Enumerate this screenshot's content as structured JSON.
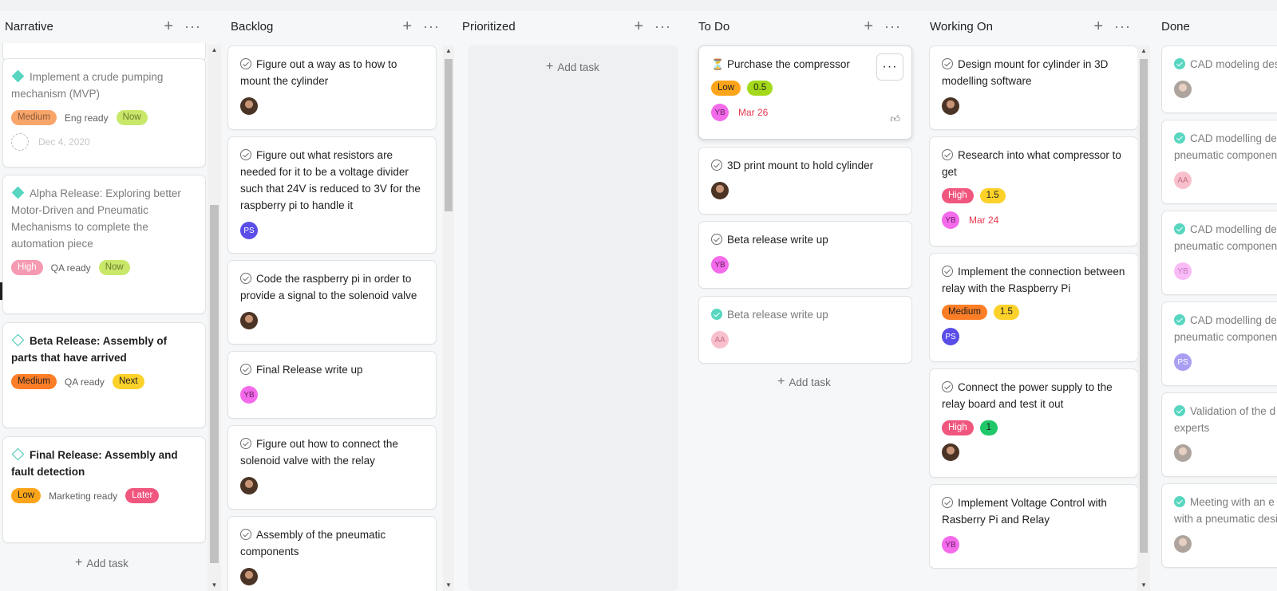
{
  "columns": [
    {
      "title": "Narrative",
      "add_task": "Add task",
      "cards": [
        {
          "title": "Implement a crude pumping mechanism (MVP)",
          "priority": "Medium",
          "status": "Eng ready",
          "timing": "Now",
          "due": "Dec 4, 2020"
        },
        {
          "title": "Alpha Release: Exploring better Motor-Driven and Pneumatic Mechanisms to complete the automation piece",
          "priority": "High",
          "status": "QA ready",
          "timing": "Now"
        },
        {
          "title": "Beta Release: Assembly of parts that have arrived",
          "priority": "Medium",
          "status": "QA ready",
          "timing": "Next"
        },
        {
          "title": "Final Release: Assembly and fault detection",
          "priority": "Low",
          "status": "Marketing ready",
          "timing": "Later"
        }
      ]
    },
    {
      "title": "Backlog",
      "cards": [
        {
          "title": "Figure out a way as to how to mount the cylinder"
        },
        {
          "title": "Figure out what resistors are needed for it to be a voltage divider such that 24V is reduced to 3V for the raspberry pi to handle it",
          "assignee": "PS"
        },
        {
          "title": "Code the raspberry pi in order to provide a signal to the solenoid valve"
        },
        {
          "title": "Final Release write up",
          "assignee": "YB"
        },
        {
          "title": "Figure out how to connect the solenoid valve with the relay"
        },
        {
          "title": "Assembly of the pneumatic components"
        }
      ]
    },
    {
      "title": "Prioritized",
      "add_task": "Add task"
    },
    {
      "title": "To Do",
      "add_task": "Add task",
      "cards": [
        {
          "title": "Purchase the compressor",
          "priority": "Low",
          "points": "0.5",
          "assignee": "YB",
          "due": "Mar 26"
        },
        {
          "title": "3D print mount to hold cylinder"
        },
        {
          "title": "Beta release write up",
          "assignee": "YB"
        },
        {
          "title": "Beta release write up",
          "assignee": "AA"
        }
      ]
    },
    {
      "title": "Working On",
      "cards": [
        {
          "title": "Design mount for cylinder in 3D modelling software"
        },
        {
          "title": "Research into what compressor to get",
          "priority": "High",
          "points": "1.5",
          "assignee": "YB",
          "due": "Mar 24"
        },
        {
          "title": "Implement the connection between relay with the Raspberry Pi",
          "priority": "Medium",
          "points": "1.5",
          "assignee": "PS"
        },
        {
          "title": "Connect the power supply to the relay board and test it out",
          "priority": "High",
          "points": "1"
        },
        {
          "title": "Implement Voltage Control with Rasberry Pi and Relay",
          "assignee": "YB"
        }
      ]
    },
    {
      "title": "Done",
      "cards": [
        {
          "title": "CAD modeling des"
        },
        {
          "title": "CAD modelling de pneumatic componen",
          "assignee": "AA"
        },
        {
          "title": "CAD modelling de pneumatic componen",
          "assignee": "YB"
        },
        {
          "title": "CAD modelling de pneumatic componen",
          "assignee": "PS"
        },
        {
          "title": "Validation of the d experts"
        },
        {
          "title": "Meeting with an e with a pneumatic desi"
        }
      ]
    }
  ],
  "icons": {
    "add": "plus-icon",
    "more": "more-horizontal-icon",
    "like": "thumbs-up-icon"
  }
}
